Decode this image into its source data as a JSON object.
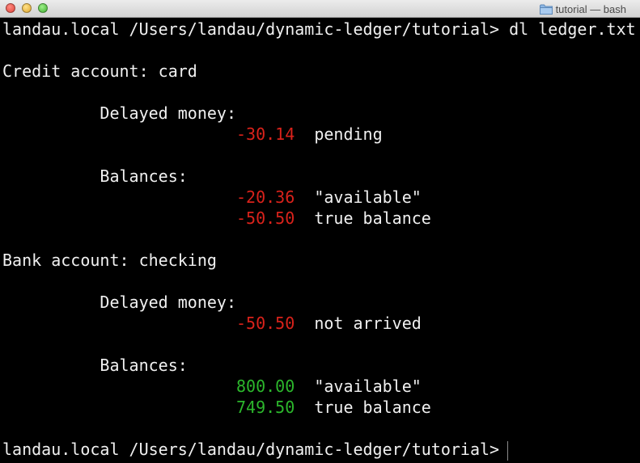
{
  "window": {
    "title": "tutorial — bash",
    "folder_icon": "folder-icon"
  },
  "colors": {
    "negative": "#d9221b",
    "positive": "#2cb72c",
    "foreground": "#f0f0f0",
    "background": "#000000"
  },
  "terminal": {
    "command_line": {
      "prompt": "landau.local /Users/landau/dynamic-ledger/tutorial> ",
      "command": "dl ledger.txt"
    },
    "credit": {
      "header": "Credit account: card",
      "delayed_label": "Delayed money:",
      "delayed": [
        {
          "amount": "-30.14",
          "note": "pending"
        }
      ],
      "balances_label": "Balances:",
      "balances": [
        {
          "amount": "-20.36",
          "note": "\"available\""
        },
        {
          "amount": "-50.50",
          "note": "true balance"
        }
      ]
    },
    "bank": {
      "header": "Bank account: checking",
      "delayed_label": "Delayed money:",
      "delayed": [
        {
          "amount": "-50.50",
          "note": "not arrived"
        }
      ],
      "balances_label": "Balances:",
      "balances": [
        {
          "amount": "800.00",
          "note": "\"available\""
        },
        {
          "amount": "749.50",
          "note": "true balance"
        }
      ]
    },
    "final_prompt": "landau.local /Users/landau/dynamic-ledger/tutorial>"
  }
}
